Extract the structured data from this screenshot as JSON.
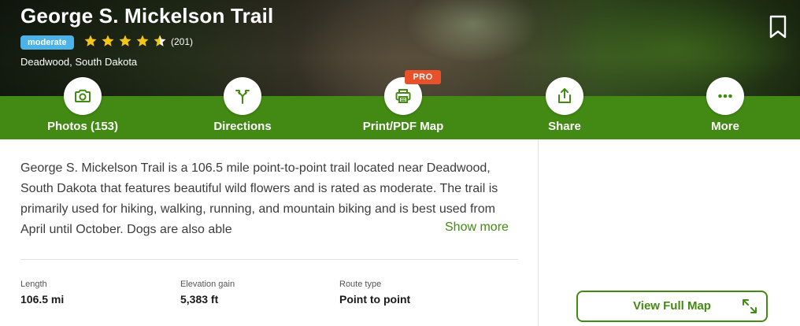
{
  "trail": {
    "title": "George S. Mickelson Trail",
    "difficulty": "moderate",
    "rating": 4.5,
    "review_count": "(201)",
    "location": "Deadwood, South Dakota"
  },
  "actions": [
    {
      "label": "Photos (153)",
      "icon": "camera-icon"
    },
    {
      "label": "Directions",
      "icon": "directions-icon"
    },
    {
      "label": "Print/PDF Map",
      "icon": "printer-icon",
      "badge": "PRO"
    },
    {
      "label": "Share",
      "icon": "share-icon"
    },
    {
      "label": "More",
      "icon": "more-icon"
    }
  ],
  "description": {
    "text": "George S. Mickelson Trail is a 106.5 mile point-to-point trail located near Deadwood, South Dakota that features beautiful wild flowers and is rated as moderate. The trail is primarily used for hiking, walking, running, and mountain biking and is best used from April until October. Dogs are also able",
    "show_more": "Show more"
  },
  "stats": [
    {
      "label": "Length",
      "value": "106.5 mi"
    },
    {
      "label": "Elevation gain",
      "value": "5,383 ft"
    },
    {
      "label": "Route type",
      "value": "Point to point"
    }
  ],
  "map": {
    "view_full_map": "View Full Map"
  },
  "colors": {
    "brand_green": "#428a13",
    "difficulty_blue": "#4bb3e8",
    "pro_orange": "#e8512a",
    "star_yellow": "#f5c518"
  }
}
